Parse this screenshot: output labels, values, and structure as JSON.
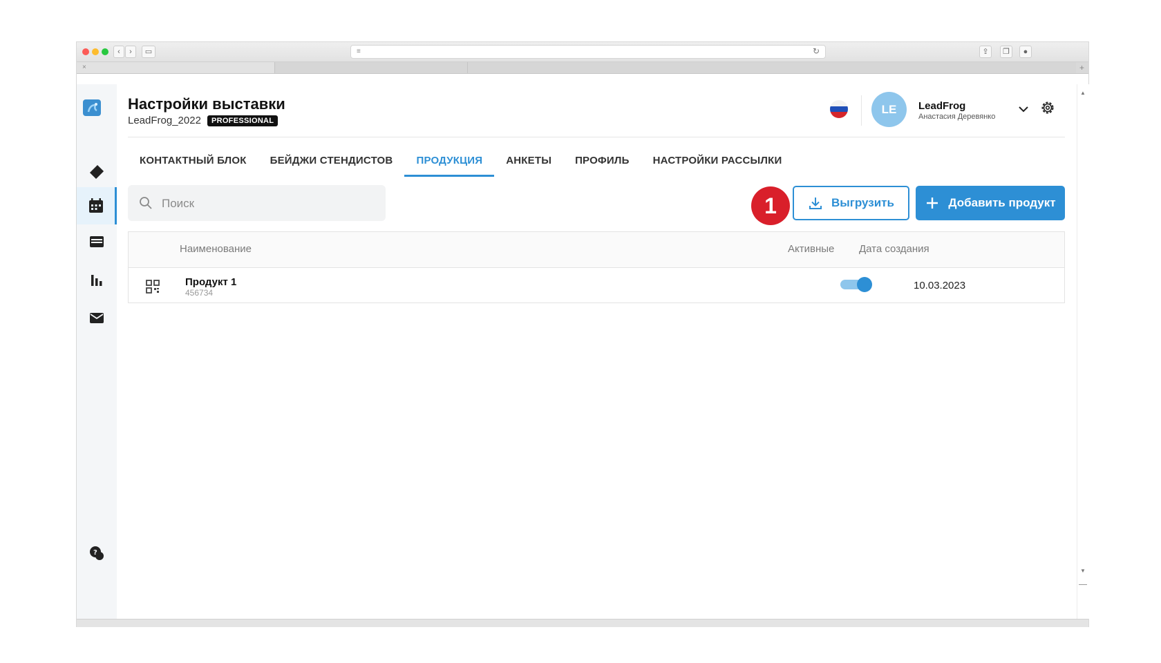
{
  "page": {
    "title": "Настройки выставки",
    "exhibition": "LeadFrog_2022",
    "plan_badge": "PROFESSIONAL"
  },
  "user": {
    "initials": "LE",
    "company": "LeadFrog",
    "name": "Анастасия Деревянко"
  },
  "tabs": [
    {
      "label": "КОНТАКТНЫЙ БЛОК",
      "active": false
    },
    {
      "label": "БЕЙДЖИ СТЕНДИСТОВ",
      "active": false
    },
    {
      "label": "ПРОДУКЦИЯ",
      "active": true
    },
    {
      "label": "АНКЕТЫ",
      "active": false
    },
    {
      "label": "ПРОФИЛЬ",
      "active": false
    },
    {
      "label": "НАСТРОЙКИ РАССЫЛКИ",
      "active": false
    }
  ],
  "search": {
    "placeholder": "Поиск"
  },
  "toolbar": {
    "marker": "1",
    "export_label": "Выгрузить",
    "add_label": "Добавить продукт"
  },
  "table": {
    "headers": {
      "name": "Наименование",
      "active": "Активные",
      "date": "Дата создания"
    },
    "rows": [
      {
        "name": "Продукт 1",
        "code": "456734",
        "active": true,
        "date": "10.03.2023"
      }
    ]
  },
  "colors": {
    "accent": "#2d8fd5",
    "marker": "#d91f2a",
    "avatar": "#8ec6ec"
  },
  "icons": [
    "logo-icon",
    "ticket-icon",
    "calendar-icon",
    "card-icon",
    "bar-chart-icon",
    "mail-icon",
    "help-chat-icon",
    "flag-icon",
    "chevron-down-icon",
    "gear-icon",
    "search-icon",
    "download-icon",
    "plus-icon",
    "qr-icon"
  ]
}
